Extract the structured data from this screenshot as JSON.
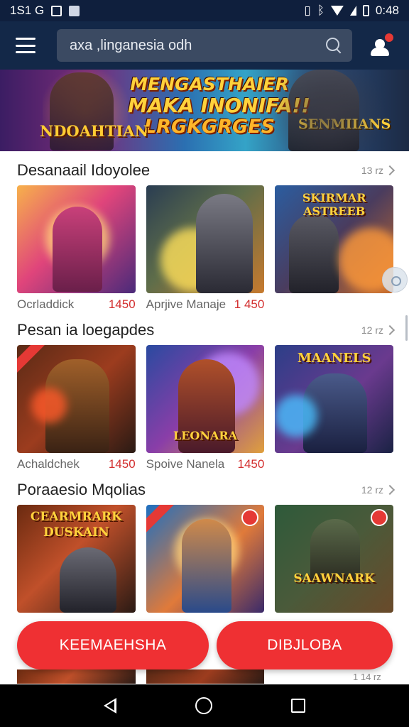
{
  "status_bar": {
    "time": "1S1 G",
    "right_time": "0:48",
    "icons": [
      "notification-square-icon",
      "image-icon",
      "vibrate-icon",
      "bluetooth-icon",
      "wifi-icon",
      "signal-icon",
      "battery-icon"
    ]
  },
  "header": {
    "search_text": "axa ,linganesia odh",
    "icons": [
      "menu-icon",
      "search-icon",
      "user-icon"
    ]
  },
  "banner": {
    "title_line1": "MENGASTHAIER",
    "title_line2": "MAKA INONIFA!!",
    "title_line3": "LRGKGRGES",
    "left_logo": "NDOAHTIAN",
    "right_logo": "SENMIIANS"
  },
  "sections": [
    {
      "title": "Desanaail Idoyolee",
      "more": "13 rz",
      "cards": [
        {
          "name": "Ocrladdick",
          "price": "1450",
          "art_text": ""
        },
        {
          "name": "Aprjive Manaje",
          "price": "1 450",
          "art_text": ""
        },
        {
          "name": "",
          "price": "",
          "art_text": "SKIRMAR ASTREEB"
        }
      ]
    },
    {
      "title": "Pesan ia loegapdes",
      "more": "12 rz",
      "cards": [
        {
          "name": "Achaldchek",
          "price": "1450",
          "art_text": ""
        },
        {
          "name": "Spoive Nanela",
          "price": "1450",
          "art_text": "LEONARA"
        },
        {
          "name": "",
          "price": "",
          "art_text": "MAANELS"
        }
      ]
    },
    {
      "title": "Poraaesio Mqolias",
      "more": "12 rz",
      "cards": [
        {
          "name": "",
          "price": "",
          "art_text": "CEARMRARK DUSKAIN"
        },
        {
          "name": "",
          "price": "",
          "art_text": ""
        },
        {
          "name": "",
          "price": "",
          "art_text": "SAAWNARK"
        }
      ]
    }
  ],
  "actions": {
    "left_label": "KEEMAEHSHA",
    "right_label": "DIBJLOBA"
  },
  "peek": {
    "more": "1 14 rz"
  },
  "colors": {
    "header_bg": "#132848",
    "accent_red": "#ef3033",
    "price_red": "#d32f2f"
  }
}
